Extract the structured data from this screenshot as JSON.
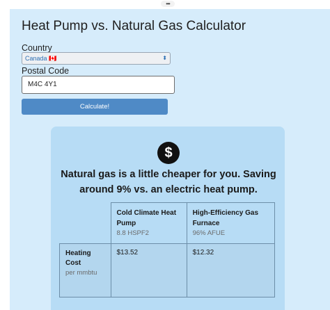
{
  "browser": {
    "more_glyph": "•••"
  },
  "page": {
    "title": "Heat Pump vs. Natural Gas Calculator"
  },
  "form": {
    "country_label": "Country",
    "country_value": "Canada 🇨🇦",
    "postal_label": "Postal Code",
    "postal_value": "M4C 4Y1",
    "submit_label": "Calculate!"
  },
  "result": {
    "icon": "dollar-circle-icon",
    "headline": "Natural gas is a little cheaper for you. Saving around 9% vs. an electric heat pump.",
    "columns": [
      {
        "name": "Cold Climate Heat Pump",
        "spec": "8.8 HSPF2"
      },
      {
        "name": "High-Efficiency Gas Furnace",
        "spec": "96% AFUE"
      }
    ],
    "rows": [
      {
        "label": "Heating Cost",
        "unit": "per mmbtu",
        "values": [
          "$13.52",
          "$12.32"
        ]
      }
    ]
  }
}
